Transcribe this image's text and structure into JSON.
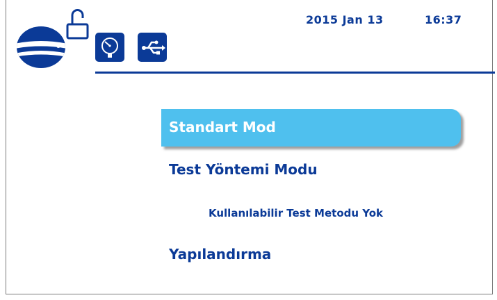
{
  "header": {
    "date": "2015 Jan 13",
    "time": "16:37",
    "icons": [
      "unlocked-padlock-icon",
      "pressure-gauge-icon",
      "usb-icon"
    ]
  },
  "menu": {
    "items": [
      {
        "label": "Standart Mod",
        "selected": true
      },
      {
        "label": "Test Yöntemi Modu",
        "selected": false
      },
      {
        "label": "Yapılandırma",
        "selected": false
      }
    ],
    "test_method_info": "Kullanılabilir Test Metodu Yok"
  },
  "colors": {
    "brand_blue": "#0b3a97",
    "selection": "#4fc0ee",
    "background": "#ffffff"
  }
}
